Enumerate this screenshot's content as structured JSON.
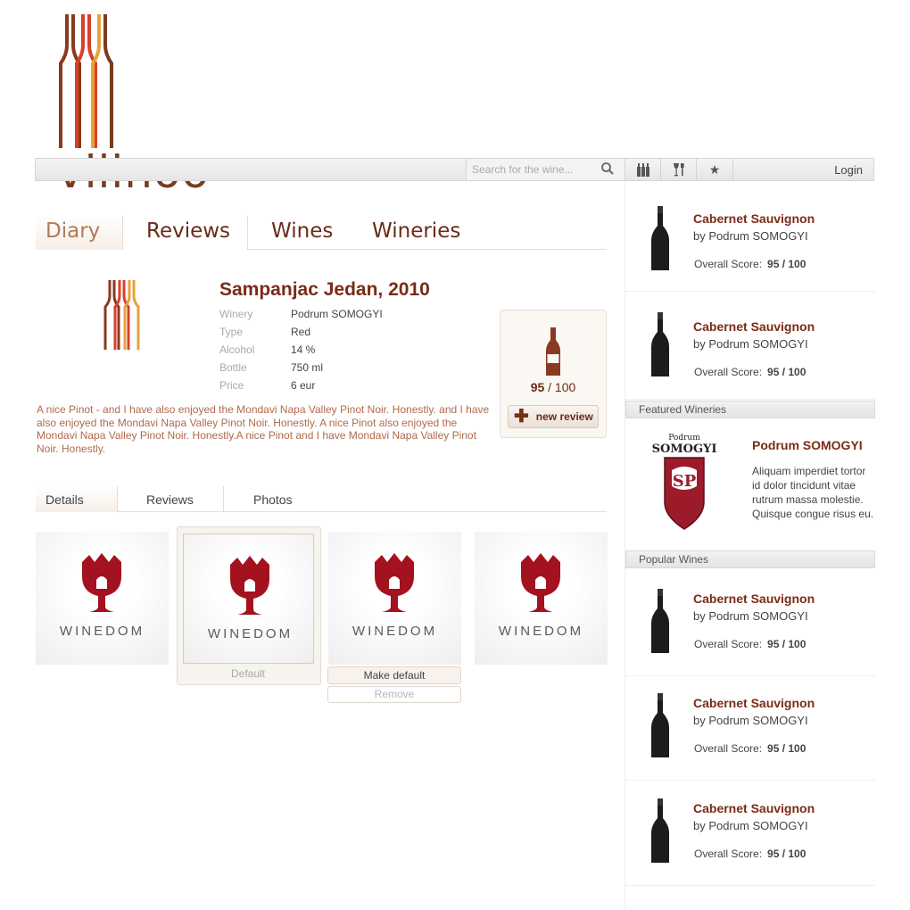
{
  "brand": {
    "logo_text": "viiinoo"
  },
  "topbar": {
    "search_placeholder": "Search for the wine...",
    "icons": [
      "search-icon",
      "bottles-icon",
      "glass-fork-icon",
      "star-icon"
    ],
    "login_label": "Login"
  },
  "main_tabs": [
    {
      "label": "Diary"
    },
    {
      "label": "Reviews"
    },
    {
      "label": "Wines"
    },
    {
      "label": "Wineries"
    }
  ],
  "wine": {
    "title": "Sampanjac Jedan, 2010",
    "info": [
      {
        "label": "Winery",
        "value": "Podrum SOMOGYI"
      },
      {
        "label": "Type",
        "value": "Red"
      },
      {
        "label": "Alcohol",
        "value": "14 %"
      },
      {
        "label": "Bottle",
        "value": "750 ml"
      },
      {
        "label": "Price",
        "value": "6 eur"
      }
    ],
    "description": "A nice Pinot - and I have also enjoyed the Mondavi Napa Valley Pinot Noir. Honestly. and I have also enjoyed the Mondavi Napa Valley Pinot Noir. Honestly. A nice Pinot also enjoyed the Mondavi Napa Valley Pinot Noir. Honestly.A nice Pinot and I have Mondavi Napa Valley Pinot Noir. Honestly."
  },
  "score_box": {
    "score": "95",
    "max": "/ 100",
    "new_review_label": "new review"
  },
  "sub_tabs": [
    {
      "label": "Details"
    },
    {
      "label": "Reviews"
    },
    {
      "label": "Photos"
    }
  ],
  "photos": {
    "brand_label": "WINEDOM",
    "default_label": "Default",
    "make_default_label": "Make default",
    "remove_label": "Remove"
  },
  "sidebar": {
    "top_wines": [
      {
        "name": "Cabernet Sauvignon",
        "by": "by Podrum SOMOGYI",
        "score_label": "Overall Score:",
        "score": "95 / 100"
      },
      {
        "name": "Cabernet Sauvignon",
        "by": "by Podrum SOMOGYI",
        "score_label": "Overall Score:",
        "score": "95 / 100"
      }
    ],
    "featured_title": "Featured Wineries",
    "featured_winery": {
      "name": "Podrum SOMOGYI",
      "logo_small": "Podrum",
      "logo_big": "SOMOGYI",
      "description": "Aliquam imperdiet tortor id dolor tincidunt vitae rutrum massa molestie. Quisque congue risus eu."
    },
    "popular_title": "Popular Wines",
    "popular_wines": [
      {
        "name": "Cabernet Sauvignon",
        "by": "by Podrum SOMOGYI",
        "score_label": "Overall Score:",
        "score": "95 / 100"
      },
      {
        "name": "Cabernet Sauvignon",
        "by": "by Podrum SOMOGYI",
        "score_label": "Overall Score:",
        "score": "95 / 100"
      },
      {
        "name": "Cabernet Sauvignon",
        "by": "by Podrum SOMOGYI",
        "score_label": "Overall Score:",
        "score": "95 / 100"
      }
    ]
  },
  "colors": {
    "brand_red": "#7a2b16",
    "accent_orange": "#e8a23a",
    "muted_text": "#a9a9a9"
  }
}
